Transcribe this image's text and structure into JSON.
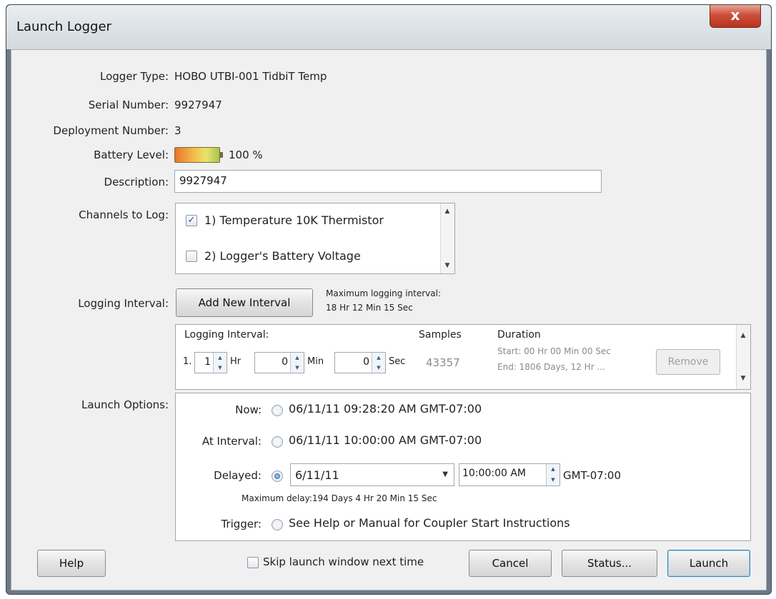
{
  "window": {
    "title": "Launch Logger",
    "close_glyph": "x"
  },
  "info": {
    "logger_type_label": "Logger Type:",
    "logger_type_value": "HOBO UTBI-001 TidbiT Temp",
    "serial_label": "Serial Number:",
    "serial_value": "9927947",
    "deployment_label": "Deployment Number:",
    "deployment_value": "3",
    "battery_label": "Battery Level:",
    "battery_value": "100 %",
    "battery_fraction": 1.0,
    "description_label": "Description:",
    "description_value": "9927947"
  },
  "channels": {
    "label": "Channels to Log:",
    "items": [
      {
        "label": "1) Temperature 10K Thermistor",
        "checked": true
      },
      {
        "label": "2) Logger's Battery Voltage",
        "checked": false
      }
    ]
  },
  "logging": {
    "label": "Logging Interval:",
    "add_button": "Add New Interval",
    "max_label": "Maximum logging interval:",
    "max_value": "18 Hr 12 Min 15 Sec",
    "header_interval": "Logging Interval:",
    "header_samples": "Samples",
    "header_duration": "Duration",
    "row_index": "1.",
    "hr_value": "1",
    "hr_unit": "Hr",
    "min_value": "0",
    "min_unit": "Min",
    "sec_value": "0",
    "sec_unit": "Sec",
    "samples": "43357",
    "start": "Start: 00 Hr 00 Min 00 Sec",
    "end": "End:  1806 Days, 12 Hr ...",
    "remove_button": "Remove"
  },
  "launch": {
    "label": "Launch Options:",
    "now_label": "Now:",
    "now_value": "06/11/11 09:28:20 AM GMT-07:00",
    "interval_label": "At Interval:",
    "interval_value": "06/11/11 10:00:00 AM GMT-07:00",
    "delayed_label": "Delayed:",
    "delayed_date": "6/11/11",
    "delayed_time": "10:00:00 AM",
    "delayed_tz": "GMT-07:00",
    "max_delay": "Maximum delay:194 Days  4 Hr 20 Min 15 Sec",
    "trigger_label": "Trigger:",
    "trigger_value": "See Help or Manual for Coupler Start Instructions",
    "selected": "delayed"
  },
  "footer": {
    "help": "Help",
    "skip": "Skip launch window next time",
    "cancel": "Cancel",
    "status": "Status...",
    "launch": "Launch"
  }
}
